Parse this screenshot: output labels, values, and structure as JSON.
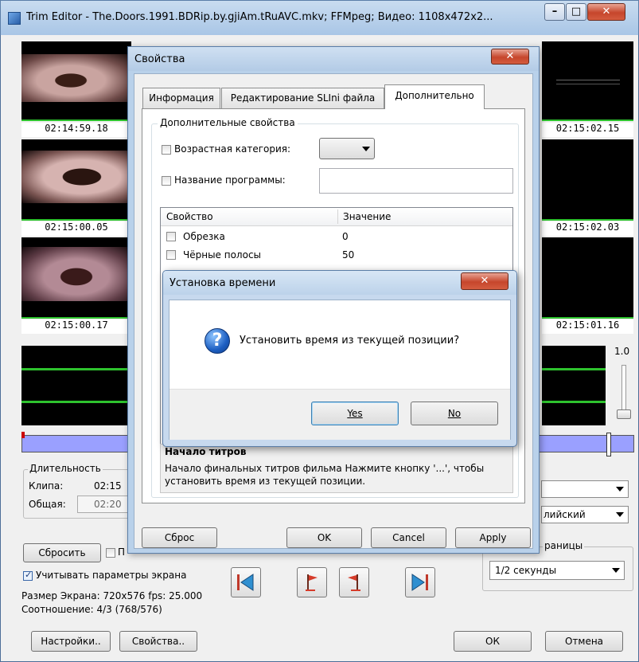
{
  "main_window": {
    "title": "Trim Editor - The.Doors.1991.BDRip.by.gjiAm.tRuAVC.mkv; FFMpeg; Видео: 1108x472x2...",
    "minimize": "–",
    "maximize": "□",
    "close": "✕",
    "timecodes_left": [
      "02:14:59.18",
      "02:15:00.05",
      "02:15:00.17"
    ],
    "timecodes_right": [
      "02:15:02.15",
      "02:15:02.03",
      "02:15:01.16"
    ],
    "zoom_value": "1.0",
    "duration": {
      "group_label": "Длительность",
      "clip_label": "Клипа:",
      "clip_value": "02:15",
      "total_label": "Общая:",
      "total_value": "02:20"
    },
    "right_combo_2_value": "лийский",
    "step_group_label": "раницы",
    "step_combo_value": "1/2 секунды",
    "reset_button": "Сбросить",
    "checkbox_partial": "П",
    "screen_params_label": "Учитывать параметры экрана",
    "screen_size_text": "Размер Экрана: 720x576 fps: 25.000",
    "aspect_text": "Соотношение: 4/3 (768/576)",
    "settings_button": "Настройки..",
    "properties_button": "Свойства..",
    "ok_button": "ОК",
    "cancel_button": "Отмена"
  },
  "properties_dialog": {
    "title": "Свойства",
    "close": "✕",
    "tabs": [
      "Информация",
      "Редактирование SLIni файла",
      "Дополнительно"
    ],
    "group_label": "Дополнительные свойства",
    "age_label": "Возрастная категория:",
    "program_label": "Название программы:",
    "table_header_property": "Свойство",
    "table_header_value": "Значение",
    "rows": [
      {
        "name": "Обрезка",
        "value": "0"
      },
      {
        "name": "Чёрные полосы",
        "value": "50"
      }
    ],
    "hint_title": "Начало титров",
    "hint_text": "Начало финальных титров фильма Нажмите кнопку '...', чтобы установить время из текущей позиции.",
    "reset_button": "Сброс",
    "ok_button": "OK",
    "cancel_button": "Cancel",
    "apply_button": "Apply"
  },
  "confirm_dialog": {
    "title": "Установка времени",
    "close": "✕",
    "icon": "question-icon",
    "message": "Установить время из текущей позиции?",
    "yes_button": "Yes",
    "no_button": "No"
  }
}
